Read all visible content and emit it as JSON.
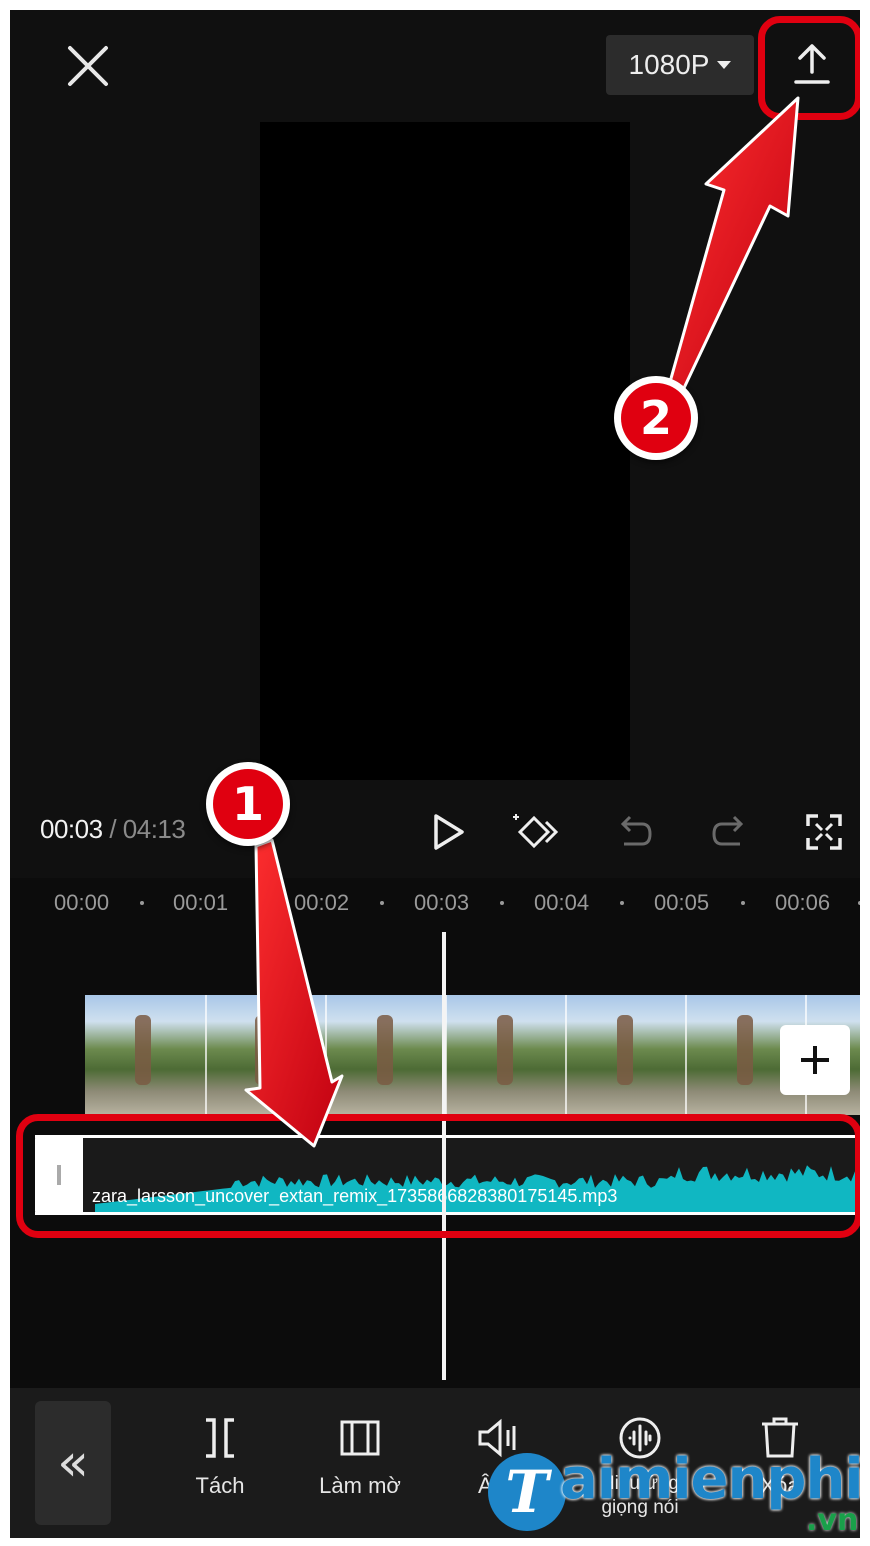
{
  "header": {
    "resolution_label": "1080P",
    "icons": {
      "close": "close-icon",
      "export": "upload-icon",
      "dropdown": "caret-down-icon"
    }
  },
  "player": {
    "current_time": "00:03",
    "separator": "/",
    "total_time": "04:13"
  },
  "timeline": {
    "ruler": [
      "00:00",
      "00:01",
      "00:02",
      "00:03",
      "00:04",
      "00:05",
      "00:06"
    ],
    "audio_clip_name": "zara_larsson_uncover_extan_remix_1735866828380175145.mp3",
    "audio_color": "#10b7c2"
  },
  "toolbar": {
    "collapse_label": "«",
    "tools": [
      {
        "label": "Tách",
        "icon": "split-icon"
      },
      {
        "label": "Làm mờ",
        "icon": "fade-icon"
      },
      {
        "label": "Âm l",
        "icon": "volume-icon"
      },
      {
        "label": "Hiệu ứng giọng nói",
        "icon": "voice-effect-icon"
      },
      {
        "label": "Xóa",
        "icon": "delete-icon"
      }
    ]
  },
  "annotations": {
    "step1": "1",
    "step2": "2",
    "highlight_color": "#e00010"
  },
  "watermark": {
    "logo_letter": "T",
    "brand": "aimienphi",
    "tld": ".vn"
  }
}
